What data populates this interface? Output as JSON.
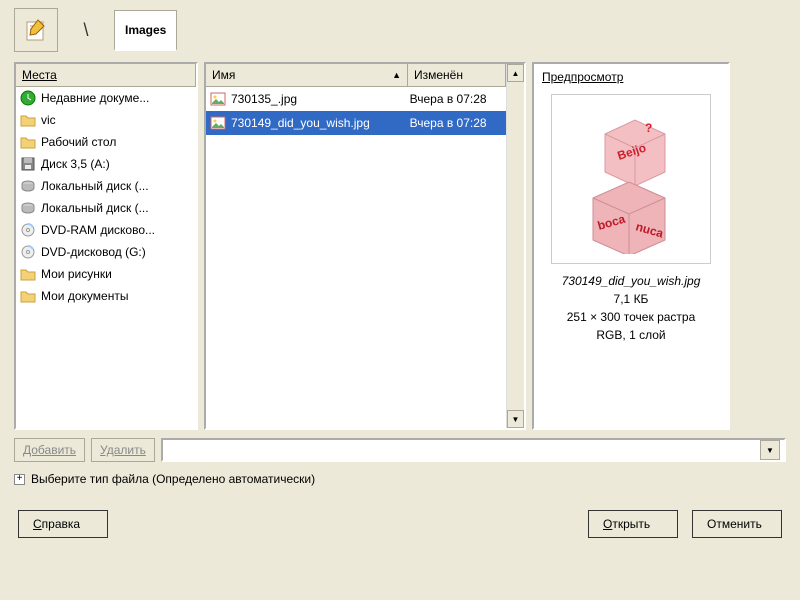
{
  "tab_label": "Images",
  "places_header": "Места",
  "name_header": "Имя",
  "date_header": "Изменён",
  "preview_header": "Предпросмотр",
  "places": [
    {
      "label": "Недавние докуме...",
      "icon": "recent"
    },
    {
      "label": "vic",
      "icon": "folder"
    },
    {
      "label": "Рабочий стол",
      "icon": "folder"
    },
    {
      "label": "Диск 3,5 (A:)",
      "icon": "floppy"
    },
    {
      "label": "Локальный диск (...",
      "icon": "hdd"
    },
    {
      "label": "Локальный диск (...",
      "icon": "hdd"
    },
    {
      "label": "DVD-RAM дисково...",
      "icon": "cd"
    },
    {
      "label": "DVD-дисковод (G:)",
      "icon": "cd"
    },
    {
      "label": "Мои рисунки",
      "icon": "folder"
    },
    {
      "label": "Мои документы",
      "icon": "folder"
    }
  ],
  "files": [
    {
      "name": "730135_.jpg",
      "date": "Вчера в 07:28",
      "selected": false
    },
    {
      "name": "730149_did_you_wish.jpg",
      "date": "Вчера в 07:28",
      "selected": true
    }
  ],
  "preview": {
    "filename": "730149_did_you_wish.jpg",
    "size": "7,1 КБ",
    "dims": "251 × 300 точек растра",
    "mode": "RGB, 1 слой"
  },
  "btn_add": "Добавить",
  "btn_remove": "Удалить",
  "filetype_label": "Выберите тип файла (Определено автоматически)",
  "btn_help": "Справка",
  "btn_open": "Открыть",
  "btn_cancel": "Отменить"
}
